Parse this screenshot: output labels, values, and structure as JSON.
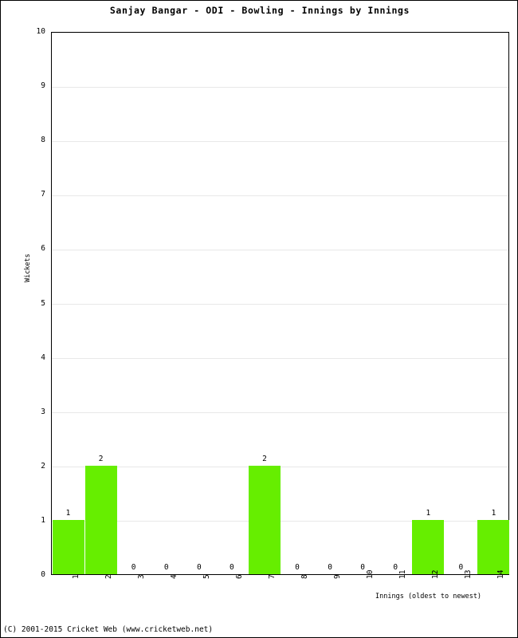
{
  "chart_data": {
    "type": "bar",
    "title": "Sanjay Bangar - ODI - Bowling - Innings by Innings",
    "xlabel": "Innings (oldest to newest)",
    "ylabel": "Wickets",
    "categories": [
      "1",
      "2",
      "3",
      "4",
      "5",
      "6",
      "7",
      "8",
      "9",
      "10",
      "11",
      "12",
      "13",
      "14"
    ],
    "values": [
      1,
      2,
      0,
      0,
      0,
      0,
      2,
      0,
      0,
      0,
      0,
      1,
      0,
      1
    ],
    "data_labels": [
      "1",
      "2",
      "0",
      "0",
      "0",
      "0",
      "2",
      "0",
      "0",
      "0",
      "0",
      "1",
      "0",
      "1"
    ],
    "ylim": [
      0,
      10
    ],
    "yticks": [
      "0",
      "1",
      "2",
      "3",
      "4",
      "5",
      "6",
      "7",
      "8",
      "9",
      "10"
    ],
    "grid": true,
    "legend": "none",
    "bar_color": "#66ee00",
    "background": "#ffffff",
    "axis_color": "#000000"
  },
  "footer": {
    "copyright": "(C) 2001-2015 Cricket Web (www.cricketweb.net)"
  }
}
